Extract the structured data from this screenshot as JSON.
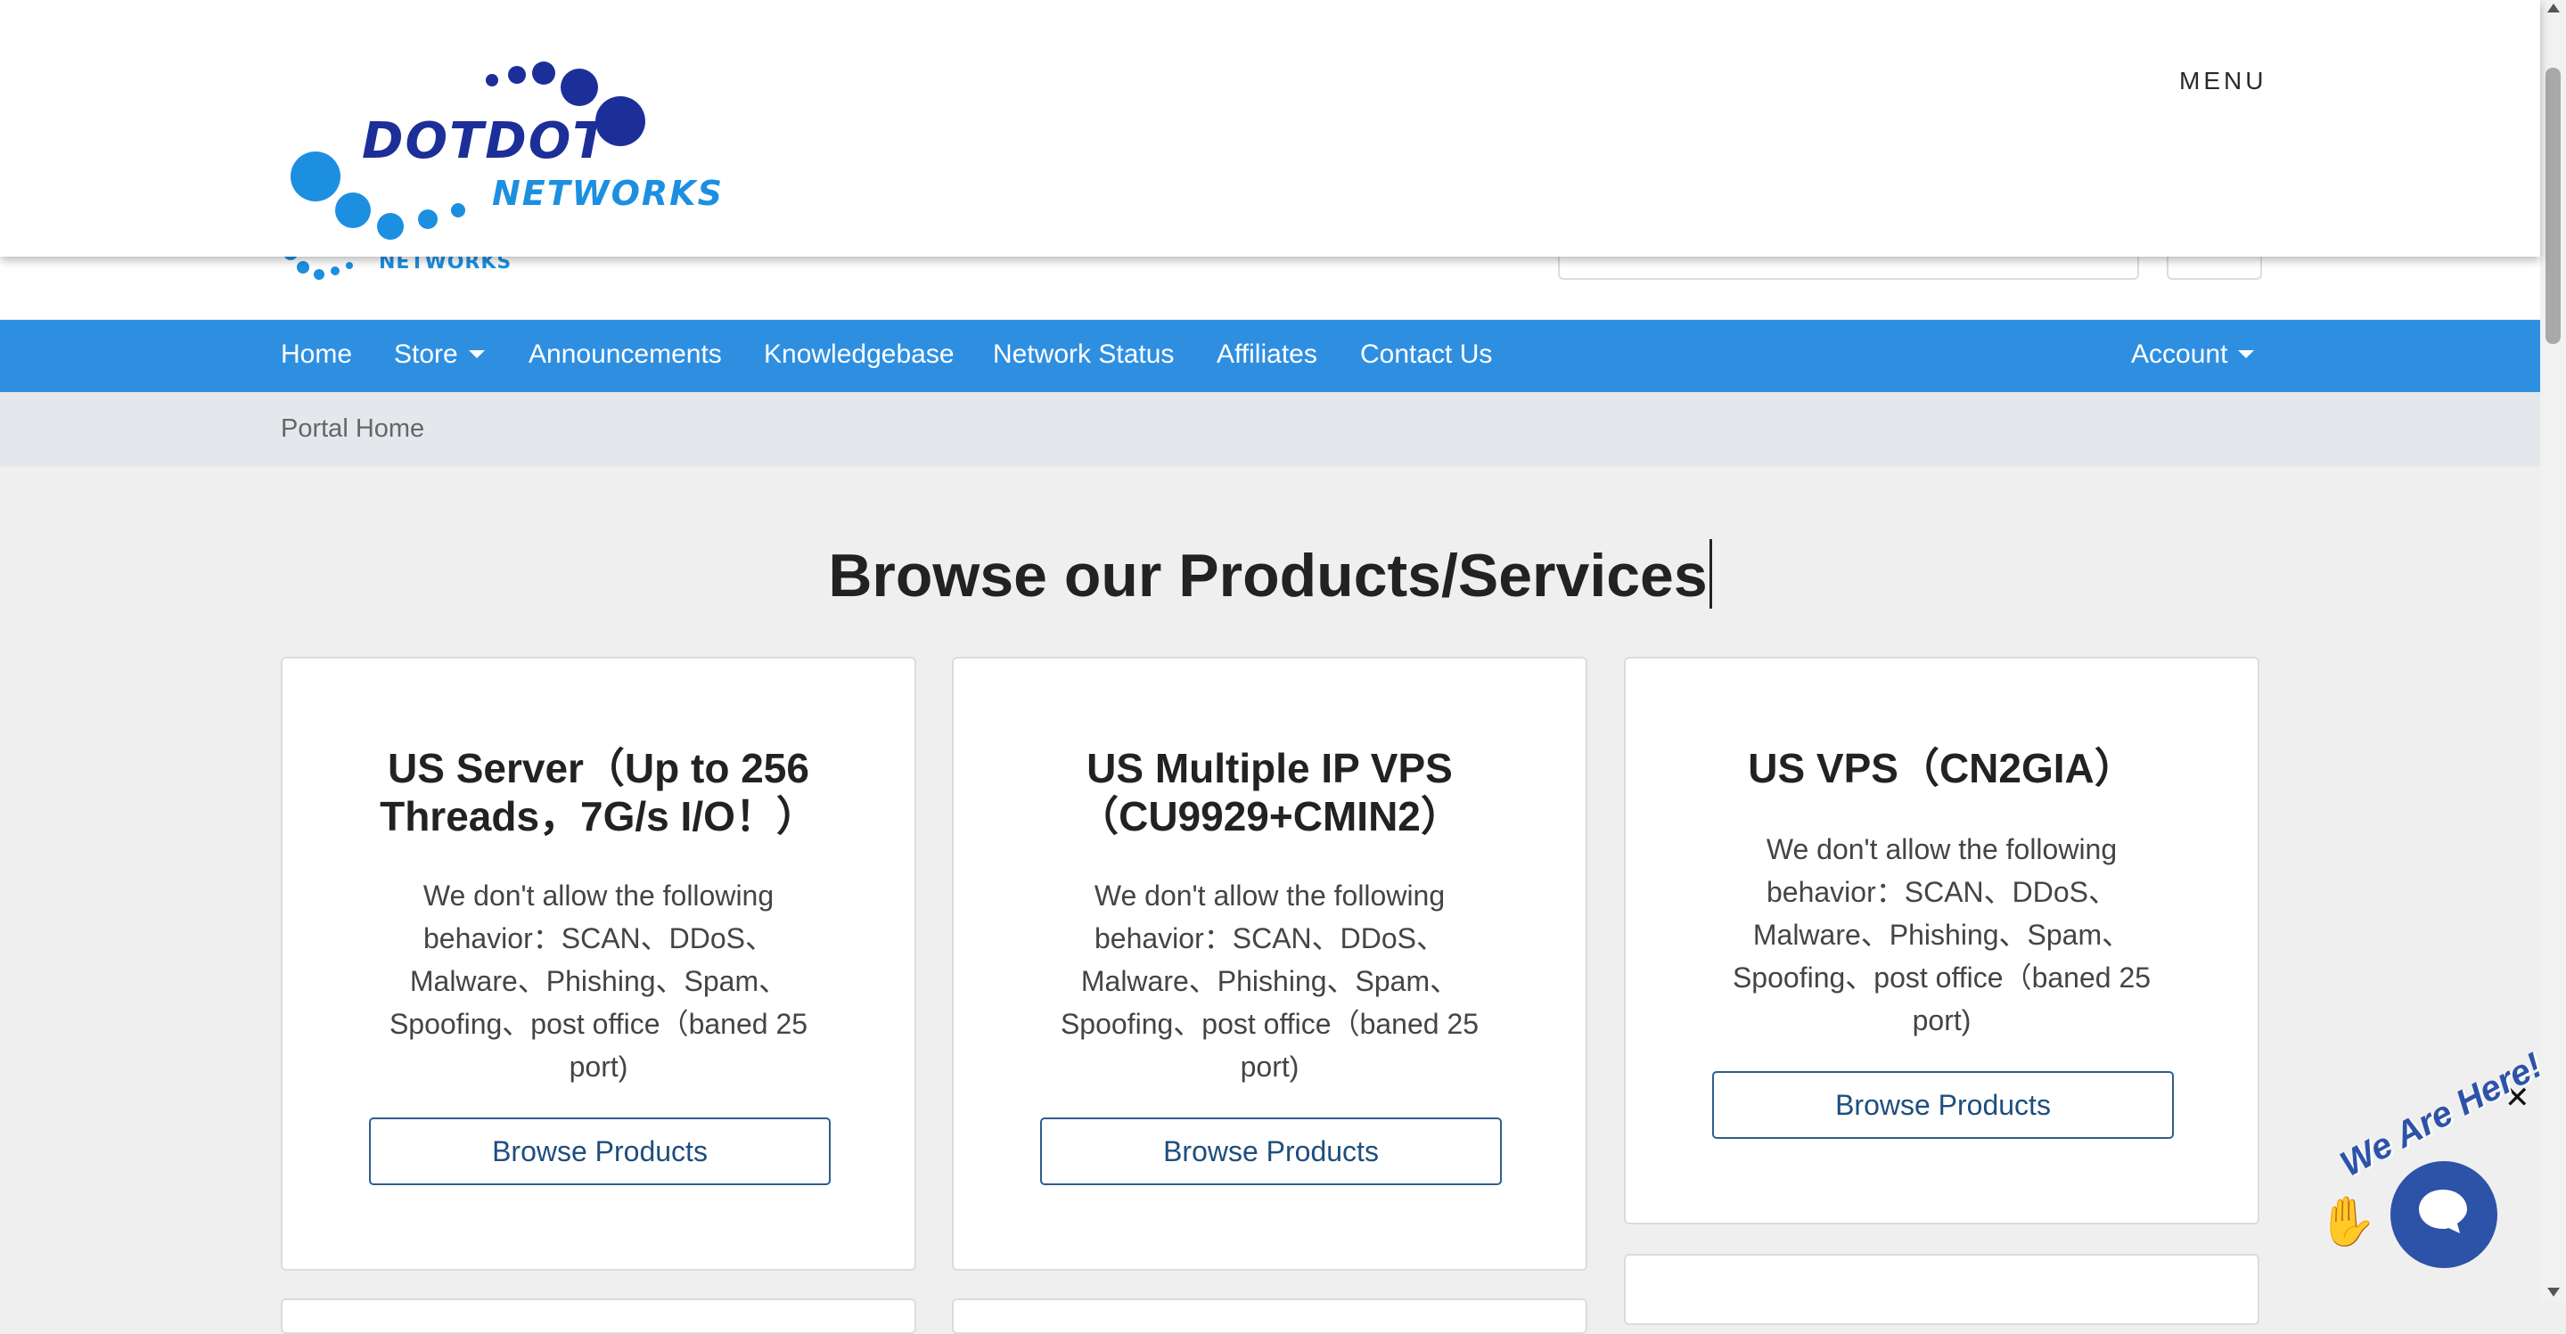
{
  "brand": {
    "logo_line1": "DOTDOT",
    "logo_line2": "NETWORKS",
    "colors": {
      "primary": "#1c2f99",
      "accent": "#1d8fe1",
      "navbar": "#2e8fe1"
    }
  },
  "header": {
    "menu_label": "MENU"
  },
  "nav": {
    "items": [
      "Home",
      "Store",
      "Announcements",
      "Knowledgebase",
      "Network Status",
      "Affiliates",
      "Contact Us"
    ],
    "account_label": "Account"
  },
  "breadcrumb": {
    "current": "Portal Home"
  },
  "main": {
    "title": "Browse our Products/Services",
    "cards": [
      {
        "title": "US Server（Up to 256 Threads，7G/s I/O！）",
        "description": "We don't allow the following behavior：SCAN、DDoS、Malware、Phishing、Spam、Spoofing、post office（baned 25 port)",
        "button": "Browse Products"
      },
      {
        "title": "US Multiple IP VPS（CU9929+CMIN2）",
        "description": "We don't allow the following behavior：SCAN、DDoS、Malware、Phishing、Spam、Spoofing、post office（baned 25 port)",
        "button": "Browse Products"
      },
      {
        "title": "US VPS（CN2GIA）",
        "description": "We don't allow the following behavior：SCAN、DDoS、Malware、Phishing、Spam、Spoofing、post office（baned 25 port)",
        "button": "Browse Products"
      }
    ]
  },
  "chat": {
    "tagline": "We Are Here!",
    "close_symbol": "✕",
    "icons": {
      "wave": "waving-hand-icon",
      "bubble": "chat-bubble-icon"
    }
  }
}
